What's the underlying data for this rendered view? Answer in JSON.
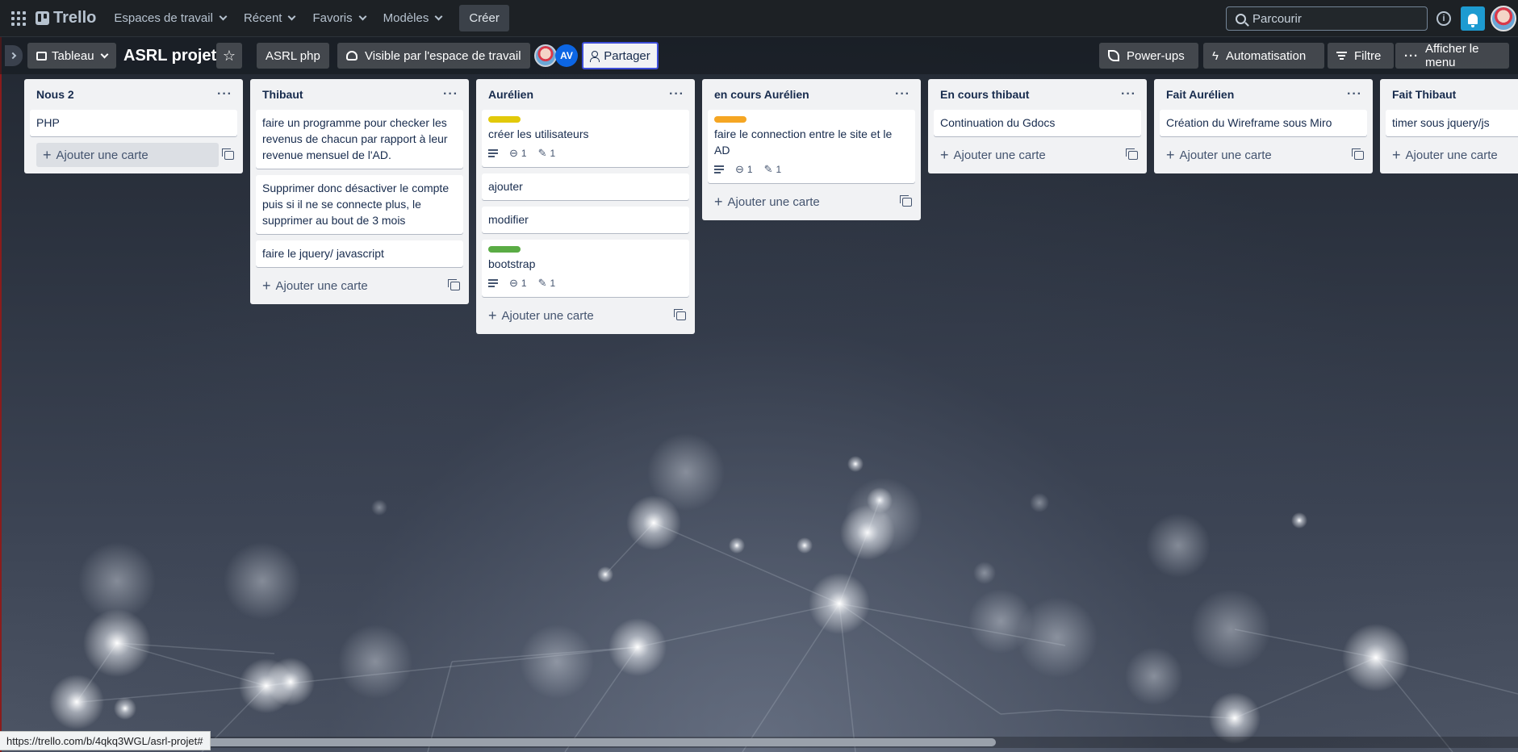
{
  "topbar": {
    "logo_text": "Trello",
    "nav": [
      {
        "label": "Espaces de travail"
      },
      {
        "label": "Récent"
      },
      {
        "label": "Favoris"
      },
      {
        "label": "Modèles"
      }
    ],
    "create_label": "Créer",
    "search_placeholder": "Parcourir",
    "info_glyph": "i"
  },
  "board": {
    "view_label": "Tableau",
    "title": "ASRL projet",
    "star_glyph": "☆",
    "workspace_label": "ASRL php",
    "visibility_label": "Visible par l'espace de travail",
    "member_initials": "AV",
    "share_label": "Partager",
    "powerups_label": "Power-ups",
    "automation_label": "Automatisation",
    "filter_label": "Filtre",
    "menu_label": "Afficher le menu"
  },
  "list_menu_glyph": "···",
  "add_card_label": "Ajouter une carte",
  "lists": [
    {
      "title": "Nous 2",
      "cards": [
        {
          "text": "PHP"
        }
      ]
    },
    {
      "title": "Thibaut",
      "cards": [
        {
          "text": "faire un programme pour checker les revenus de chacun par rapport à leur revenue mensuel de l'AD."
        },
        {
          "text": "Supprimer donc désactiver le compte puis si il ne se connecte plus, le supprimer au bout de 3 mois"
        },
        {
          "text": "faire le jquery/ javascript"
        }
      ]
    },
    {
      "title": "Aurélien",
      "cards": [
        {
          "text": "créer les utilisateurs",
          "label_color": "#e2c90a",
          "attachments": "1",
          "checklist": "1"
        },
        {
          "text": "ajouter"
        },
        {
          "text": "modifier"
        },
        {
          "text": "bootstrap",
          "label_color": "#5aac44",
          "attachments": "1",
          "checklist": "1"
        }
      ]
    },
    {
      "title": "en cours Aurélien",
      "cards": [
        {
          "text": "faire le connection entre le site et le AD",
          "label_color": "#f5a623",
          "attachments": "1",
          "checklist": "1"
        }
      ]
    },
    {
      "title": "En cours thibaut",
      "cards": [
        {
          "text": "Continuation du Gdocs"
        }
      ]
    },
    {
      "title": "Fait Aurélien",
      "cards": [
        {
          "text": "Création du Wireframe sous Miro"
        }
      ]
    },
    {
      "title": "Fait Thibaut",
      "cards": [
        {
          "text": "timer sous jquery/js"
        }
      ]
    }
  ],
  "status_url": "https://trello.com/b/4qkq3WGL/asrl-projet#",
  "colors": {
    "topbar_bg": "#1d2125",
    "list_bg": "#f1f2f4",
    "share_border": "#3d4dd6",
    "bell_bg": "#1d9bd1"
  }
}
